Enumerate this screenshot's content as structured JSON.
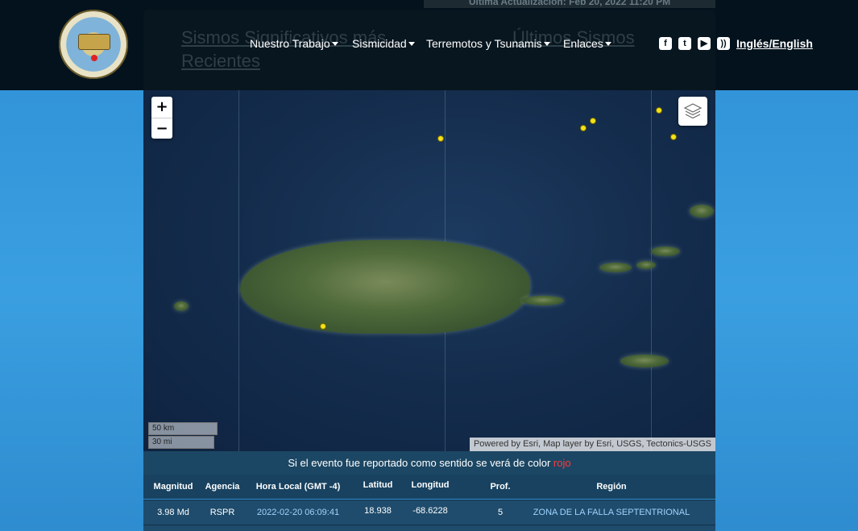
{
  "header": {
    "top_bar_text": "Última Actualización: Feb 20, 2022 11:20 PM",
    "ghost_left": "Sismos Significativos más Recientes",
    "ghost_right": "Últimos Sismos",
    "nav": [
      {
        "label": "Nuestro Trabajo"
      },
      {
        "label": "Sismicidad"
      },
      {
        "label": "Terremotos y Tsunamis"
      },
      {
        "label": "Enlaces"
      }
    ],
    "social_icons": [
      "facebook-icon",
      "twitter-icon",
      "youtube-icon",
      "rss-icon"
    ],
    "language_link": "Inglés/English"
  },
  "map": {
    "zoom_in": "+",
    "zoom_out": "−",
    "scale_km": "50 km",
    "scale_mi": "30 mi",
    "attribution": "Powered by Esri, Map layer by Esri, USGS, Tectonics-USGS"
  },
  "table": {
    "notice_prefix": "Si el evento fue reportado como sentido se verá de color ",
    "notice_color_word": "rojo",
    "headers": [
      "Magnitud",
      "Agencia",
      "Hora Local (GMT -4)",
      "Latitud",
      "Longitud",
      "Prof.",
      "Región"
    ],
    "rows": [
      [
        "3.98 Md",
        "RSPR",
        "2022-02-20 06:09:41",
        "18.938",
        "-68.6228",
        "5",
        "ZONA DE LA FALLA SEPTENTRIONAL"
      ]
    ]
  },
  "colors": {
    "header_bg": "#03121c",
    "quake_marker": "#f3e21a",
    "felt_color": "#ff3b3b"
  }
}
